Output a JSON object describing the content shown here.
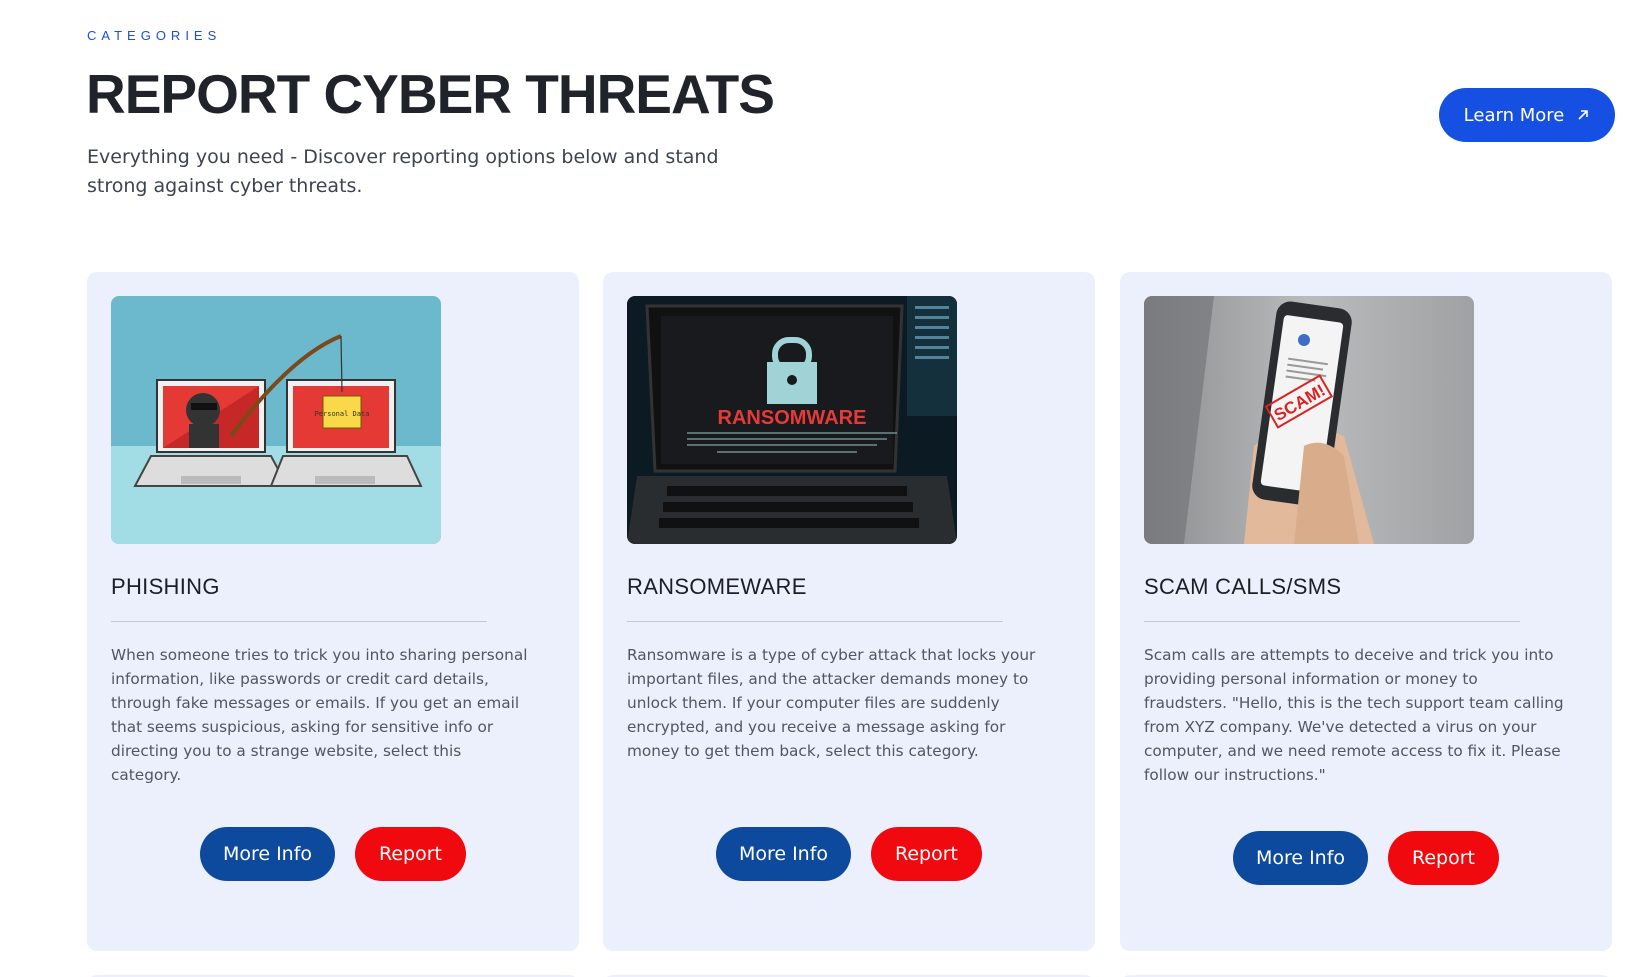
{
  "header": {
    "eyebrow": "CATEGORIES",
    "title": "REPORT CYBER THREATS",
    "intro": "Everything you need - Discover reporting options below and stand strong against cyber threats.",
    "learn_more_label": "Learn More"
  },
  "cards": [
    {
      "title": "PHISHING",
      "image_text": "Personal Data",
      "description": "When someone tries to trick you into sharing personal information, like passwords or credit card details, through fake messages or emails. If you get an email that seems suspicious, asking for sensitive info or directing you to a strange website, select this category.",
      "more_info_label": "More Info",
      "report_label": "Report"
    },
    {
      "title": "RANSOMEWARE",
      "image_text": "RANSOMWARE",
      "description": "Ransomware is a type of cyber attack that locks your important files, and the attacker demands money to unlock them. If your computer files are suddenly encrypted, and you receive a message asking for money to get them back, select this category.",
      "more_info_label": "More Info",
      "report_label": "Report"
    },
    {
      "title": "SCAM CALLS/SMS",
      "image_text": "SCAM!",
      "description": "Scam calls are attempts to deceive and trick you into providing personal information or money to fraudsters. \"Hello, this is the tech support team calling from XYZ company. We've detected a virus on your computer, and we need remote access to fix it. Please follow our instructions.\"",
      "more_info_label": "More Info",
      "report_label": "Report"
    }
  ],
  "colors": {
    "accent": "#1550e3",
    "more_info": "#0d4a9e",
    "report": "#f0090e",
    "card_bg": "#ecf0fd"
  }
}
